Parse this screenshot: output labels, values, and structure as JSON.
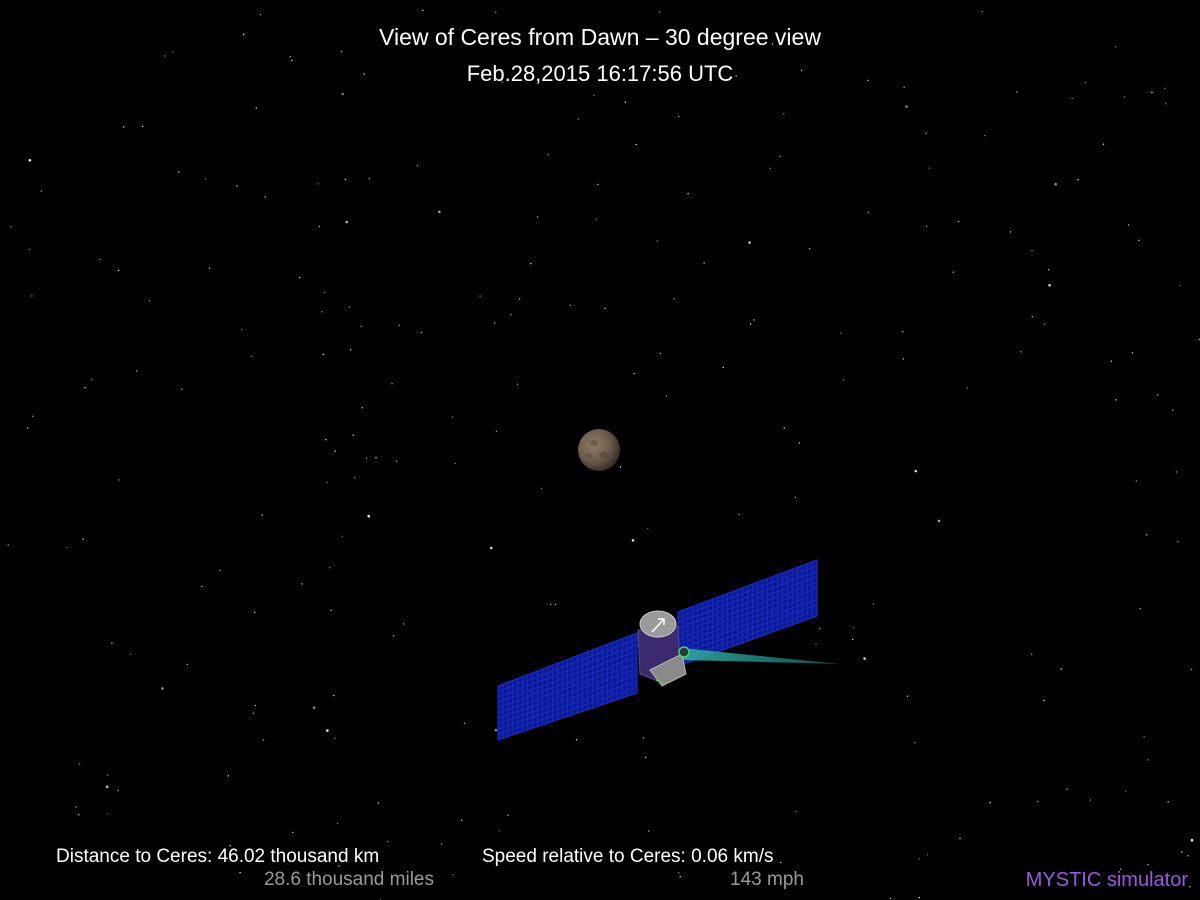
{
  "title": "View of Ceres from Dawn – 30 degree view",
  "timestamp": "Feb.28,2015 16:17:56  UTC",
  "distance": {
    "label": "Distance to Ceres: 46.02 thousand km",
    "secondary": "28.6 thousand miles"
  },
  "speed": {
    "label": "Speed relative to Ceres: 0.06 km/s",
    "secondary": "143 mph"
  },
  "brand": {
    "label": "MYSTIC simulator",
    "color": "#9b59e0"
  },
  "colors": {
    "background": "#000000",
    "primary_text": "#ffffff",
    "secondary_text": "#9a9a9a",
    "solar_panel": "#0a1a9c",
    "spacecraft_bus": "#3d2a6e",
    "thrust_beam": "#2fa6a0"
  }
}
